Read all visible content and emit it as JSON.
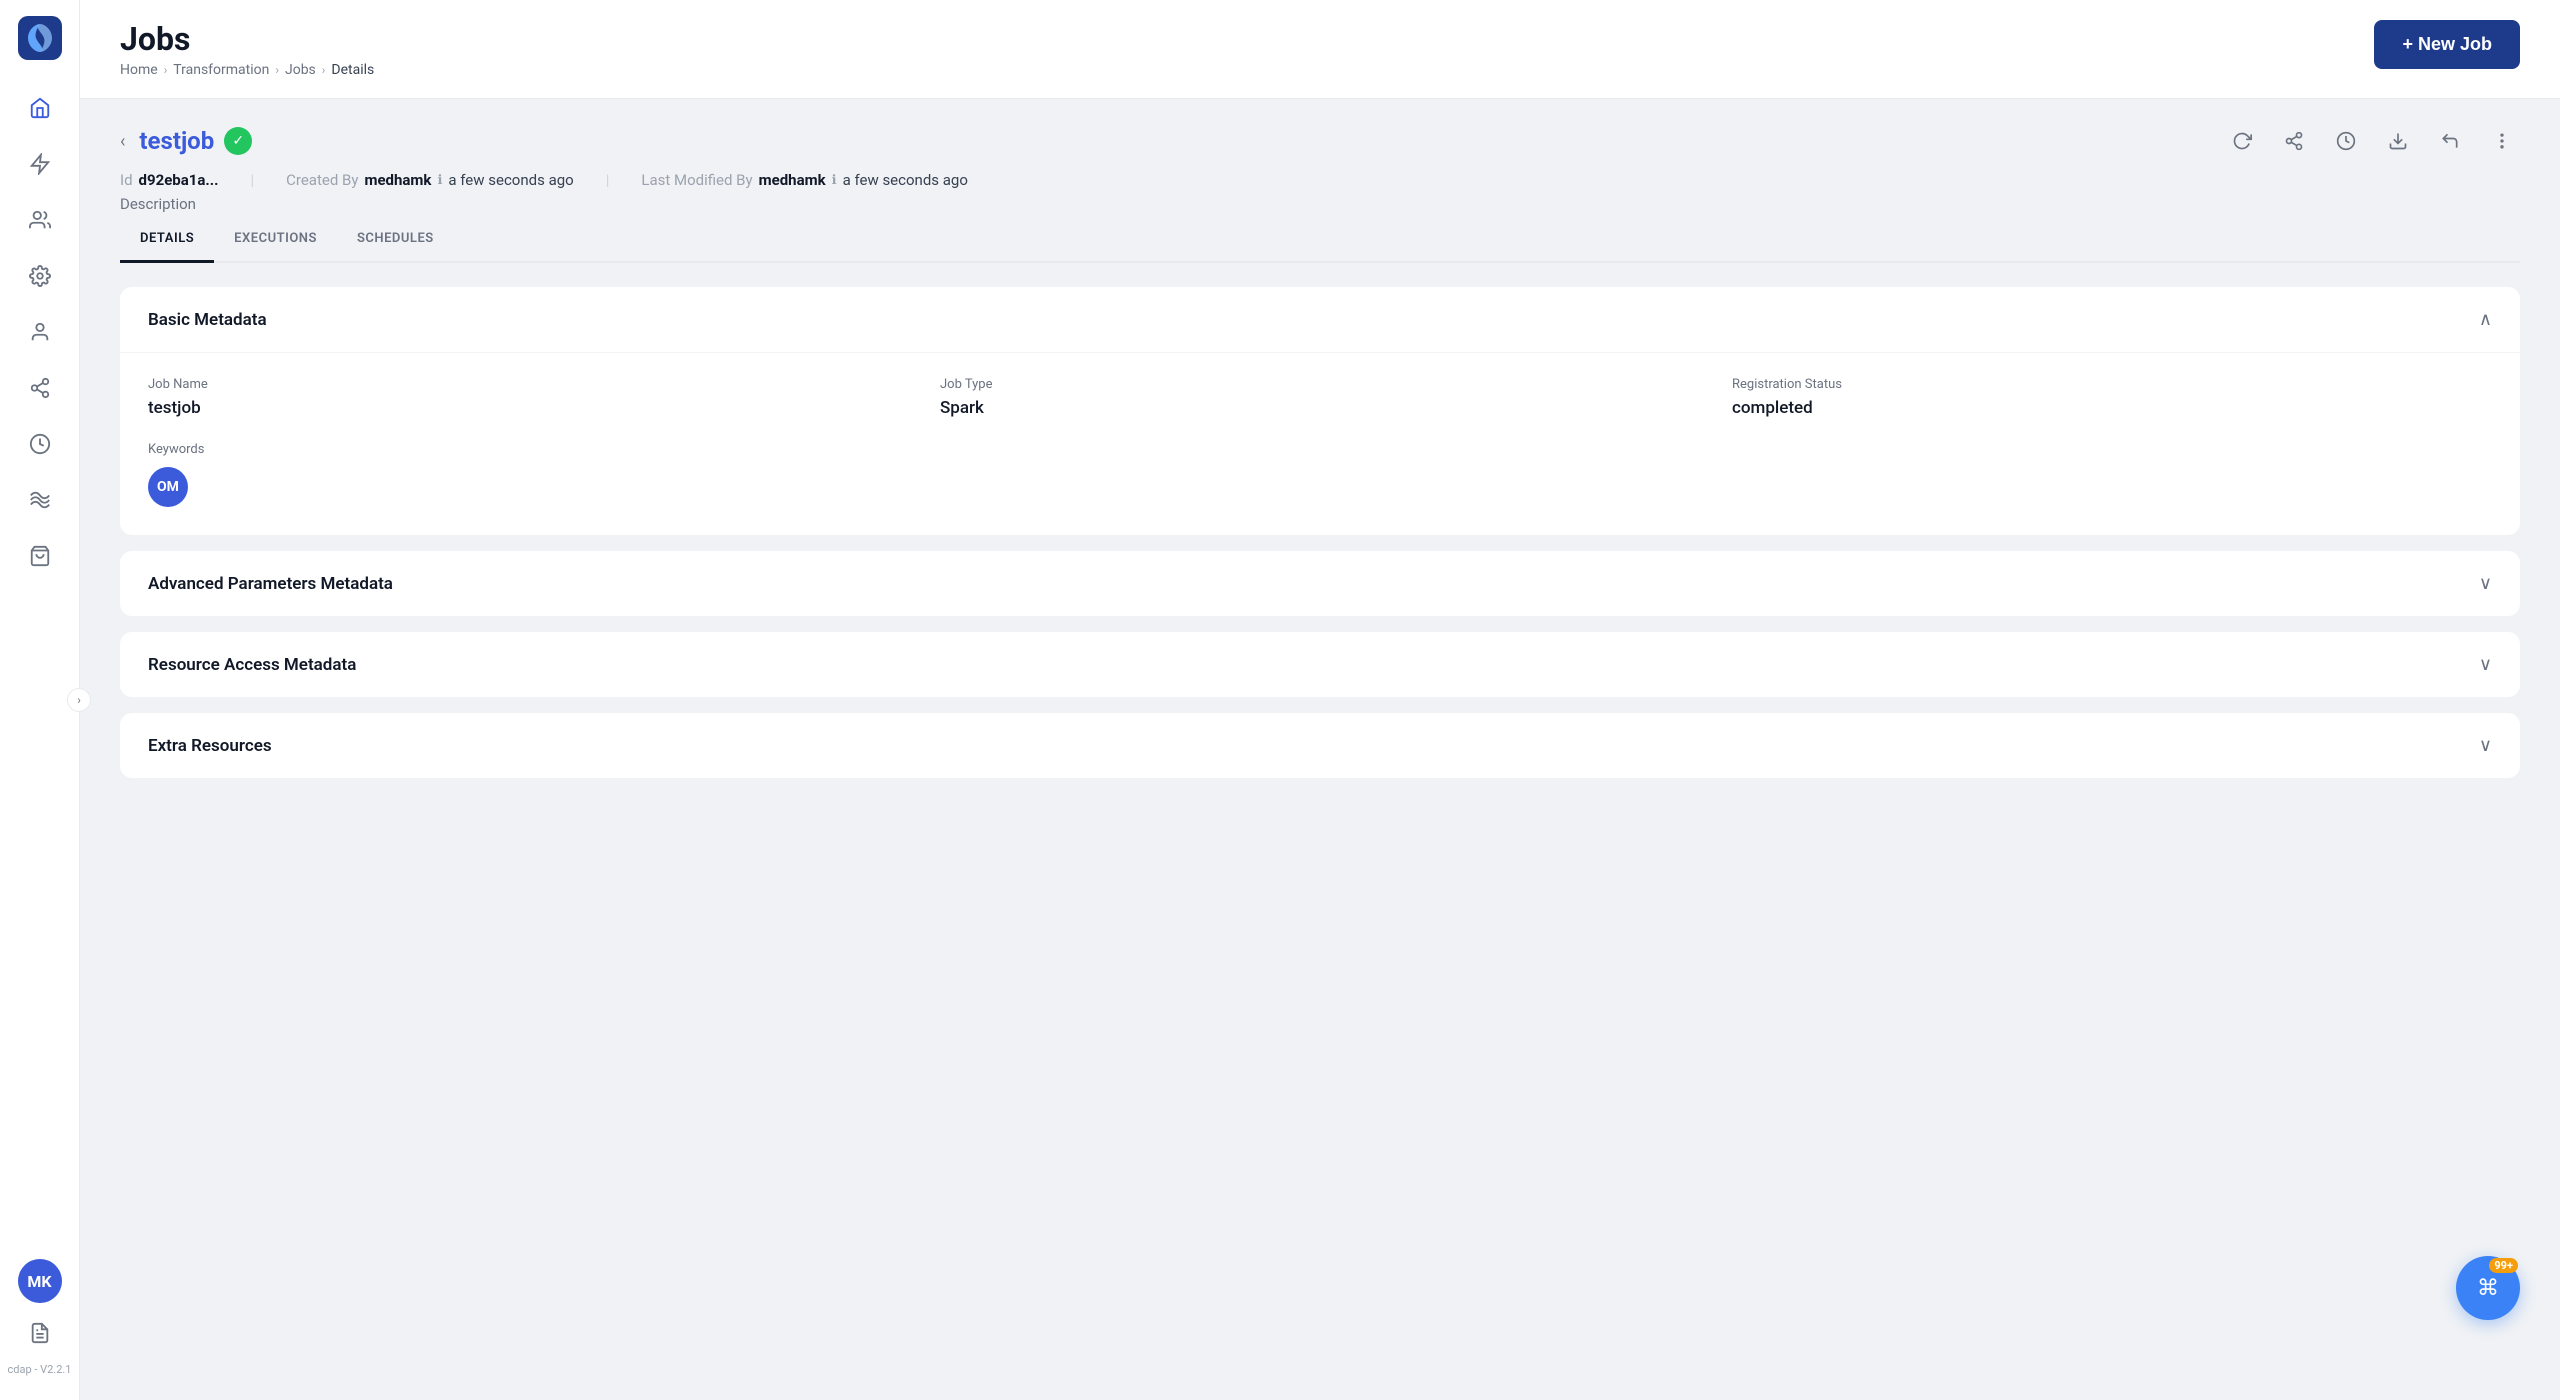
{
  "app": {
    "logo_alt": "cdap logo",
    "version": "cdap - V2.2.1"
  },
  "sidebar": {
    "icons": [
      {
        "name": "home-icon",
        "symbol": "⌂",
        "label": "Home"
      },
      {
        "name": "filter-icon",
        "symbol": "⚡",
        "label": "Filter"
      },
      {
        "name": "users-icon",
        "symbol": "👥",
        "label": "Users"
      },
      {
        "name": "settings-icon",
        "symbol": "⚙",
        "label": "Settings"
      },
      {
        "name": "person-icon",
        "symbol": "👤",
        "label": "Person"
      },
      {
        "name": "connections-icon",
        "symbol": "⇄",
        "label": "Connections"
      },
      {
        "name": "clock-icon",
        "symbol": "◷",
        "label": "Clock"
      },
      {
        "name": "waves-icon",
        "symbol": "〰",
        "label": "Waves"
      },
      {
        "name": "bag-icon",
        "symbol": "🎒",
        "label": "Bag"
      }
    ],
    "avatar_initials": "MK",
    "docs_icon": "📄"
  },
  "header": {
    "title": "Jobs",
    "breadcrumbs": [
      "Home",
      "Transformation",
      "Jobs",
      "Details"
    ],
    "new_job_label": "+ New Job"
  },
  "job": {
    "name": "testjob",
    "status": "completed",
    "id_label": "Id",
    "id_value": "d92eba1a...",
    "created_by_label": "Created By",
    "created_by": "medhamk",
    "created_time": "a few seconds ago",
    "modified_by_label": "Last Modified By",
    "modified_by": "medhamk",
    "modified_time": "a few seconds ago",
    "description_label": "Description"
  },
  "tabs": [
    {
      "id": "details",
      "label": "DETAILS",
      "active": true
    },
    {
      "id": "executions",
      "label": "EXECUTIONS",
      "active": false
    },
    {
      "id": "schedules",
      "label": "SCHEDULES",
      "active": false
    }
  ],
  "sections": {
    "basic_metadata": {
      "title": "Basic Metadata",
      "expanded": true,
      "fields": {
        "job_name_label": "Job Name",
        "job_name_value": "testjob",
        "job_type_label": "Job Type",
        "job_type_value": "Spark",
        "registration_status_label": "Registration Status",
        "registration_status_value": "completed",
        "keywords_label": "Keywords",
        "keyword_badge": "OM"
      }
    },
    "advanced_params": {
      "title": "Advanced Parameters Metadata",
      "expanded": false
    },
    "resource_access": {
      "title": "Resource Access Metadata",
      "expanded": false
    },
    "extra_resources": {
      "title": "Extra Resources",
      "expanded": false
    }
  },
  "action_icons": [
    {
      "name": "refresh-icon",
      "symbol": "↻"
    },
    {
      "name": "share-icon",
      "symbol": "⤴"
    },
    {
      "name": "history-icon",
      "symbol": "◷"
    },
    {
      "name": "download-icon",
      "symbol": "⬇"
    },
    {
      "name": "undo-icon",
      "symbol": "↩"
    },
    {
      "name": "more-icon",
      "symbol": "⋮"
    }
  ],
  "notification": {
    "count": "99+",
    "icon": "⌘"
  }
}
